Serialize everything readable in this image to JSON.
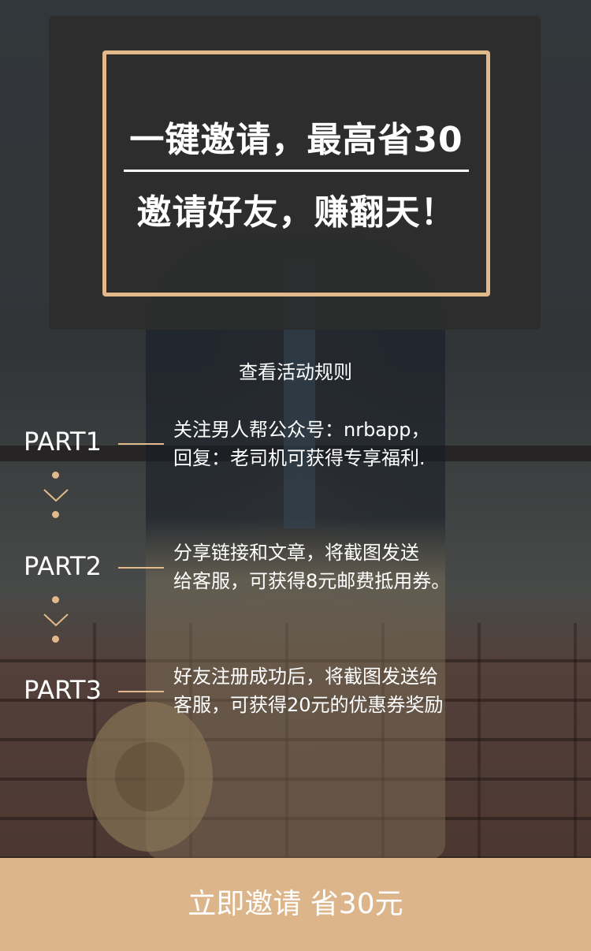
{
  "colors": {
    "accent": "#e2b98a",
    "button": "#ddb58a",
    "card": "#2d2d2d"
  },
  "header": {
    "headline_1": "一键邀请，最高省30",
    "headline_2": "邀请好友，赚翻天！"
  },
  "rules_link": "查看活动规则",
  "steps": [
    {
      "label": "PART1",
      "lines": [
        "关注男人帮公众号：nrbapp，",
        "回复：老司机可获得专享福利."
      ]
    },
    {
      "label": "PART2",
      "lines": [
        "分享链接和文章，将截图发送",
        "给客服，可获得8元邮费抵用券。"
      ]
    },
    {
      "label": "PART3",
      "lines": [
        "好友注册成功后，将截图发送给",
        "客服，可获得20元的优惠券奖励"
      ]
    }
  ],
  "step_connector_icon": "chevron-down-icon",
  "cta_label": "立即邀请   省30元"
}
